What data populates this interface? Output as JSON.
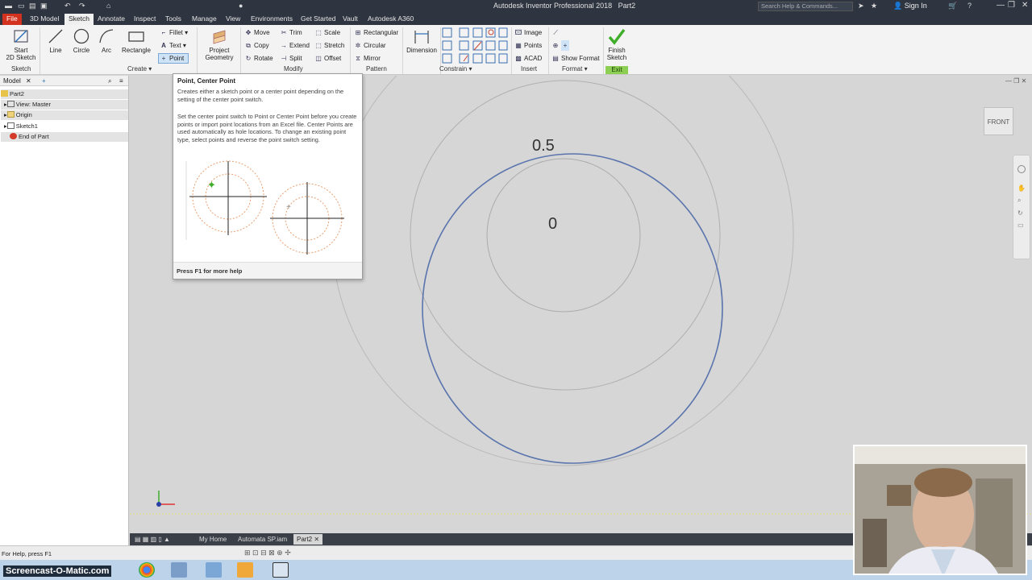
{
  "titlebar": {
    "app_title": "Autodesk Inventor Professional 2018",
    "doc_title": "Part2",
    "search_placeholder": "Search Help & Commands...",
    "sign_in": "Sign In"
  },
  "tabs": [
    "File",
    "3D Model",
    "Sketch",
    "Annotate",
    "Inspect",
    "Tools",
    "Manage",
    "View",
    "Environments",
    "Get Started",
    "Vault",
    "Autodesk A360"
  ],
  "ribbon": {
    "start_sketch": "Start\n2D Sketch",
    "line": "Line",
    "circle": "Circle",
    "arc": "Arc",
    "rectangle": "Rectangle",
    "fillet": "Fillet",
    "text": "Text",
    "point": "Point",
    "project_geometry": "Project\nGeometry",
    "move": "Move",
    "copy": "Copy",
    "rotate": "Rotate",
    "trim": "Trim",
    "extend": "Extend",
    "split": "Split",
    "scale": "Scale",
    "stretch": "Stretch",
    "offset": "Offset",
    "rect_pattern": "Rectangular",
    "circ_pattern": "Circular",
    "mirror": "Mirror",
    "dimension": "Dimension",
    "image": "Image",
    "points": "Points",
    "acad": "ACAD",
    "show_format": "Show Format",
    "finish_sketch": "Finish\nSketch",
    "panels": {
      "sketch": "Sketch",
      "create": "Create",
      "modify": "Modify",
      "pattern": "Pattern",
      "constrain": "Constrain",
      "insert": "Insert",
      "format": "Format",
      "exit": "Exit"
    }
  },
  "browser": {
    "tab": "Model",
    "nodes": [
      "Part2",
      "View: Master",
      "Origin",
      "Sketch1",
      "End of Part"
    ]
  },
  "tooltip": {
    "title": "Point, Center Point",
    "p1": "Creates either a sketch point or a center point depending on the setting of the center point switch.",
    "p2": "Set the center point switch to Point or Center Point before you create points or import point locations from an Excel file. Center Points are used automatically as hole locations. To change an existing point type, select points and reverse the point switch setting.",
    "footer": "Press F1 for more help"
  },
  "canvas": {
    "dim_top": "0.5",
    "dim_center": "0",
    "viewcube": "FRONT"
  },
  "doctabs": [
    "My Home",
    "Automata SP.iam",
    "Part2"
  ],
  "status": {
    "help": "For Help, press F1"
  },
  "watermark": "Screencast-O-Matic.com"
}
